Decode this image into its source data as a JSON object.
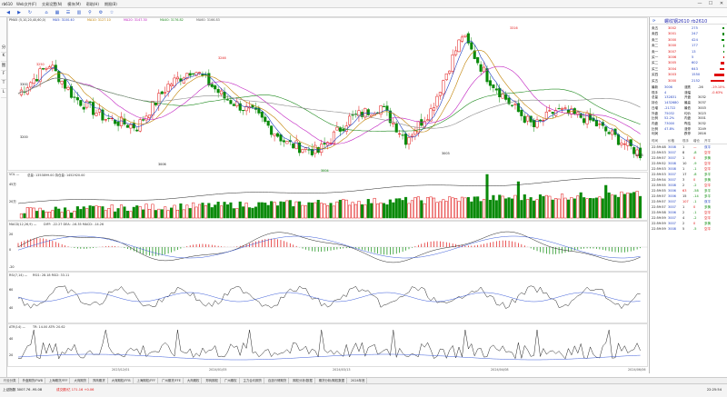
{
  "titlebar": {
    "title": "rb610",
    "menus": [
      "Web文件(F)",
      "交易设置(N)",
      "模块(M)",
      "帮助(H)",
      "期限(B)"
    ],
    "controls": [
      "—",
      "☐",
      "✕"
    ]
  },
  "left_tabs": [
    "分",
    "K",
    "图",
    "F",
    "T",
    "L"
  ],
  "chart": {
    "main_legend": "PMA5 (5,10,20,40,60,0)",
    "ma5": "MA5: 3100.40",
    "ma10": "MA10: 3127.10",
    "ma20": "MA20: 3147.30",
    "ma40": "MA40: 3176.82",
    "ma60": "MA60: 3166.83",
    "price_ticks": [
      "3300",
      "3200",
      "3100"
    ],
    "annotations": [
      {
        "label": "3250"
      },
      {
        "label": "3246"
      },
      {
        "label": "3006"
      },
      {
        "label": "3316"
      },
      {
        "label": "3004"
      },
      {
        "label": "3003"
      },
      {
        "label": "3003"
      }
    ],
    "vol_legend": "VOL —",
    "vol_vals": "总量: 1353899.00  持仓量: 1452920.00",
    "vol_ticks": [
      "45万",
      "20万"
    ],
    "macd_legend": "MACD(12,26,9) —",
    "macd_vals": "DIFF: -22.27  DEA: -16.35  MACD: -14.26",
    "macd_ticks": [
      "20",
      "0",
      "-20"
    ],
    "rsi_legend": "RSI(7,14) —",
    "rsi_vals": "RSI1: 28.18  RSI2: 33.11",
    "rsi_ticks": [
      "60",
      "40"
    ],
    "atr_legend": "ATR(14) —",
    "atr_vals": "TR: 14.00  ATR: 20.62",
    "atr_ticks": [
      "40",
      "20"
    ],
    "dates": [
      "2023/12/01",
      "2024/01/05",
      "2024/03/13",
      "2024/04/08",
      "2024/06/06"
    ]
  },
  "right_panel": {
    "title": "螺纹钢2610 rb2610",
    "sell": [
      [
        "卖五",
        "3002",
        "275"
      ],
      [
        "卖四",
        "3001",
        "247"
      ],
      [
        "卖三",
        "3000",
        "424"
      ],
      [
        "卖二",
        "3000",
        "177"
      ],
      [
        "卖一",
        "3007",
        "13"
      ]
    ],
    "buy": [
      [
        "买一",
        "3006",
        "5"
      ],
      [
        "买二",
        "3005",
        "602"
      ],
      [
        "买三",
        "3004",
        "643"
      ],
      [
        "买四",
        "3003",
        "1550"
      ],
      [
        "买五",
        "3000",
        "2152"
      ]
    ],
    "quote": [
      [
        "最新",
        "3006",
        "涨跌",
        "-26",
        "-19.10%"
      ],
      [
        "现手",
        "4",
        "涨幅",
        "",
        "-0.63%"
      ],
      [
        "总量",
        "132831",
        "开盘",
        "3032",
        ""
      ],
      [
        "持仓",
        "1432680",
        "最高",
        "3037",
        ""
      ],
      [
        "日增",
        "-21722",
        "最低",
        "3003",
        ""
      ],
      [
        "外盘",
        "75032",
        "均价",
        "3023",
        ""
      ],
      [
        "比例",
        "52.2%",
        "内盘",
        "3001",
        ""
      ],
      [
        "内盘",
        "73000",
        "昨结",
        "3032",
        ""
      ],
      [
        "比例",
        "47.8%",
        "涨停",
        "3249",
        ""
      ],
      [
        "利润",
        "",
        "跌停",
        "2816",
        ""
      ]
    ],
    "trade_header": [
      "时间",
      "价格",
      "现手",
      "增仓",
      "开平"
    ],
    "trades": [
      [
        "22:59:48",
        "3008",
        "1",
        "—",
        "双平"
      ],
      [
        "22:59:53",
        "3007",
        "8",
        "-8",
        "空平"
      ],
      [
        "22:59:57",
        "3007",
        "1",
        "0",
        "多换"
      ],
      [
        "22:59:52",
        "3008",
        "10",
        "-9",
        "空平"
      ],
      [
        "22:59:53",
        "3008",
        "1",
        "-1",
        "空平"
      ],
      [
        "22:59:53",
        "3007",
        "17",
        "-8",
        "多平"
      ],
      [
        "22:59:54",
        "3007",
        "3",
        "0",
        "多换"
      ],
      [
        "22:59:55",
        "3008",
        "2",
        "-2",
        "空平"
      ],
      [
        "22:59:55",
        "3006",
        "63",
        "-58",
        "多平"
      ],
      [
        "22:59:57",
        "3006",
        "15",
        "-14",
        "多平"
      ],
      [
        "22:59:57",
        "3007",
        "107",
        "-1",
        "双平"
      ],
      [
        "22:59:57",
        "3007",
        "1",
        "0",
        "多换"
      ],
      [
        "22:59:58",
        "3006",
        "2",
        "-1",
        "空平"
      ],
      [
        "22:59:59",
        "3007",
        "4",
        "-2",
        "空平"
      ],
      [
        "22:59:59",
        "3007",
        "2",
        "0",
        "多换"
      ],
      [
        "22:59:59",
        "3008",
        "5",
        "-5",
        "空平"
      ]
    ]
  },
  "bottom_tabs": [
    "行业分类",
    "外盘期货/FWB",
    "上海期货/FFF",
    "大商期货",
    "郑商期货",
    "大商期权/FFB",
    "上海期权/FFF",
    "广州期货/FFE",
    "大商期权",
    "郑商期权",
    "广州期权",
    "主力合约期货",
    "自选行情期货",
    "期权分析/数据",
    "期货分析/期权数据",
    "2024年底"
  ],
  "status": {
    "left": "上证指数 3007.76  -95.08",
    "mid": "成交额/亿 171.16  +0.06",
    "right": "22:25:54"
  },
  "colors": {
    "up": "#e01010",
    "down": "#0a8a0a",
    "ma5": "#1f3fbf",
    "ma10": "#c08000",
    "ma20": "#c020c0",
    "ma40": "#1f8a1f",
    "ma60": "#8a8a8a"
  }
}
